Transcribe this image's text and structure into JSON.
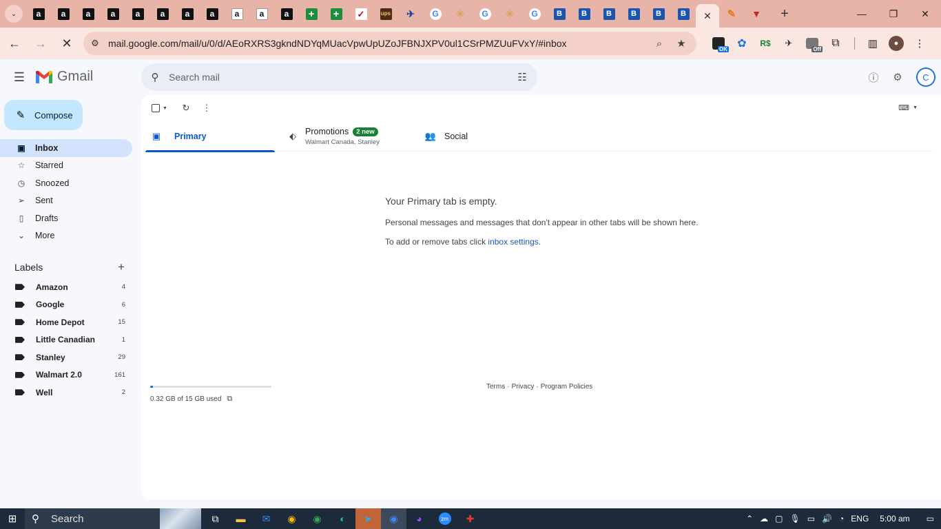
{
  "browser": {
    "tabs": [
      {
        "icon": "amazon-icon",
        "glyph": "a",
        "style": "fav-amazon"
      },
      {
        "icon": "amazon-icon",
        "glyph": "a",
        "style": "fav-amazon"
      },
      {
        "icon": "amazon-icon",
        "glyph": "a",
        "style": "fav-amazon"
      },
      {
        "icon": "amazon-icon",
        "glyph": "a",
        "style": "fav-amazon"
      },
      {
        "icon": "amazon-icon",
        "glyph": "a",
        "style": "fav-amazon"
      },
      {
        "icon": "amazon-icon",
        "glyph": "a",
        "style": "fav-amazon"
      },
      {
        "icon": "amazon-icon",
        "glyph": "a",
        "style": "fav-amazon"
      },
      {
        "icon": "amazon-icon",
        "glyph": "a",
        "style": "fav-amazon"
      },
      {
        "icon": "amazon-light-icon",
        "glyph": "a",
        "style": "fav-amazon-light"
      },
      {
        "icon": "amazon-light-icon",
        "glyph": "a",
        "style": "fav-amazon-light"
      },
      {
        "icon": "amazon-icon",
        "glyph": "a",
        "style": "fav-amazon"
      },
      {
        "icon": "green-plus-icon",
        "glyph": "+",
        "style": "fav-plus"
      },
      {
        "icon": "green-plus-icon",
        "glyph": "+",
        "style": "fav-plus"
      },
      {
        "icon": "macys-icon",
        "glyph": "✓",
        "style": "fav-macys"
      },
      {
        "icon": "ups-icon",
        "glyph": "ups",
        "style": "fav-ups"
      },
      {
        "icon": "airline-icon",
        "glyph": "✈",
        "style": "fav-flight"
      },
      {
        "icon": "google-icon",
        "glyph": "G",
        "style": "fav-g"
      },
      {
        "icon": "sparkle-icon",
        "glyph": "✳",
        "style": "fav-sparkle"
      },
      {
        "icon": "google-icon",
        "glyph": "G",
        "style": "fav-g"
      },
      {
        "icon": "sparkle-icon",
        "glyph": "✳",
        "style": "fav-sparkle"
      },
      {
        "icon": "google-icon",
        "glyph": "G",
        "style": "fav-g"
      },
      {
        "icon": "b-icon",
        "glyph": "B",
        "style": "fav-b"
      },
      {
        "icon": "b-icon",
        "glyph": "B",
        "style": "fav-b"
      },
      {
        "icon": "b-icon",
        "glyph": "B",
        "style": "fav-b"
      },
      {
        "icon": "b-icon",
        "glyph": "B",
        "style": "fav-b"
      },
      {
        "icon": "b-icon",
        "glyph": "B",
        "style": "fav-b"
      },
      {
        "icon": "b-icon",
        "glyph": "B",
        "style": "fav-b"
      }
    ],
    "after_tabs": [
      {
        "icon": "extension-tab-icon",
        "glyph": "✎",
        "style": "fav-ext"
      },
      {
        "icon": "shield-tab-icon",
        "glyph": "▼",
        "style": "fav-shield"
      }
    ],
    "url": "mail.google.com/mail/u/0/d/AEoRXRS3gkndNDYqMUacVpwUpUZoJFBNJXPV0ul1CSrPMZUuFVxY/#inbox",
    "extension_badge_ok": "OK",
    "extension_badge_off": "Off"
  },
  "gmail": {
    "logo_text": "Gmail",
    "search_placeholder": "Search mail",
    "compose_label": "Compose",
    "nav": [
      {
        "name": "inbox",
        "label": "Inbox",
        "glyph": "▣",
        "active": true
      },
      {
        "name": "starred",
        "label": "Starred",
        "glyph": "☆",
        "active": false
      },
      {
        "name": "snoozed",
        "label": "Snoozed",
        "glyph": "◷",
        "active": false
      },
      {
        "name": "sent",
        "label": "Sent",
        "glyph": "➢",
        "active": false
      },
      {
        "name": "drafts",
        "label": "Drafts",
        "glyph": "▯",
        "active": false
      },
      {
        "name": "more",
        "label": "More",
        "glyph": "⌄",
        "active": false
      }
    ],
    "labels_title": "Labels",
    "labels": [
      {
        "name": "Amazon",
        "count": "4"
      },
      {
        "name": "Google",
        "count": "6"
      },
      {
        "name": "Home Depot",
        "count": "15"
      },
      {
        "name": "Little Canadian",
        "count": "1"
      },
      {
        "name": "Stanley",
        "count": "29"
      },
      {
        "name": "Walmart 2.0",
        "count": "161"
      },
      {
        "name": "Well",
        "count": "2"
      }
    ],
    "tabs": {
      "primary": "Primary",
      "promotions": "Promotions",
      "promotions_badge": "2 new",
      "promotions_senders": "Walmart Canada, Stanley",
      "social": "Social"
    },
    "empty": {
      "title": "Your Primary tab is empty.",
      "line1": "Personal messages and messages that don't appear in other tabs will be shown here.",
      "line2_prefix": "To add or remove tabs click ",
      "line2_link": "inbox settings",
      "line2_suffix": "."
    },
    "storage": {
      "text": "0.32 GB of 15 GB used",
      "used_fraction": 0.021
    },
    "footer": {
      "terms": "Terms",
      "sep1": "·",
      "privacy": "Privacy",
      "sep2": "·",
      "policies": "Program Policies"
    }
  },
  "taskbar": {
    "search_label": "Search",
    "language": "ENG",
    "time": "5:00 am"
  },
  "colors": {
    "accent": "#0b57d0",
    "compose_bg": "#c2e7ff",
    "inbox_active_bg": "#d3e3fd",
    "promotions_badge": "#188038",
    "tabstrip_bg": "#e8b4a8"
  }
}
